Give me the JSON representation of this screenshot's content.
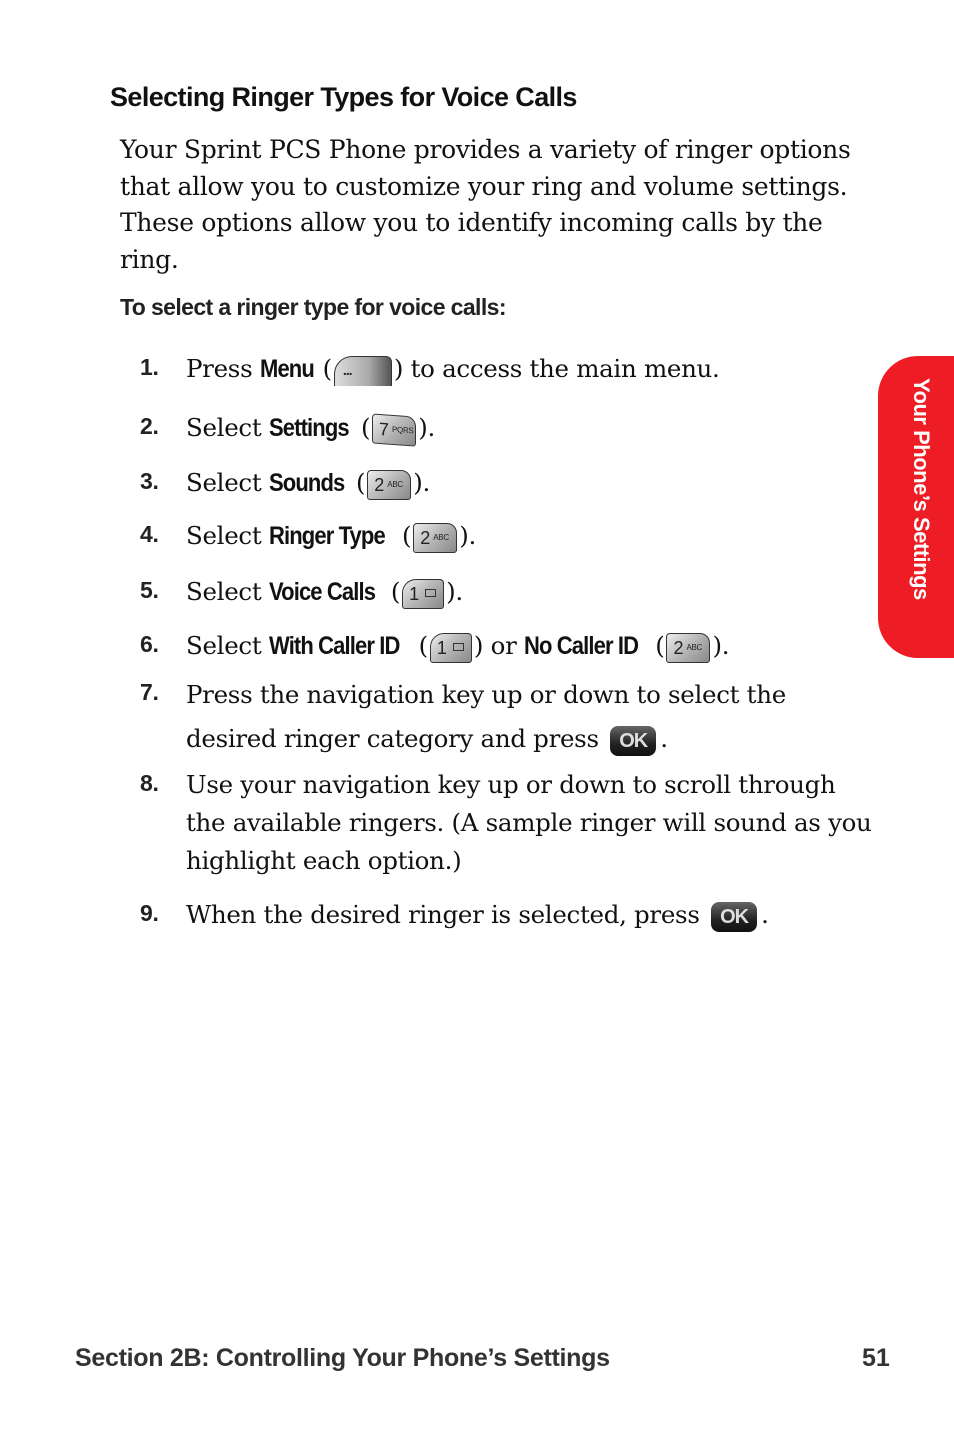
{
  "heading": "Selecting Ringer Types for Voice Calls",
  "intro": "Your Sprint PCS Phone provides a variety of ringer options that allow you to customize your ring and volume settings. These options allow you to identify incoming calls by the ring.",
  "subheading": "To select a ringer type for voice calls:",
  "steps": [
    {
      "num": "1.",
      "pre": "Press ",
      "kw": "Menu",
      "open": " (",
      "key": {
        "digit": "...",
        "letters": ""
      },
      "post": ") to access the main menu."
    },
    {
      "num": "2.",
      "pre": "Select ",
      "kw": "Settings",
      "open": " (",
      "key": {
        "digit": "7",
        "letters": "PQRS"
      },
      "post": ")."
    },
    {
      "num": "3.",
      "pre": "Select ",
      "kw": "Sounds",
      "open": " (",
      "key": {
        "digit": "2",
        "letters": "ABC"
      },
      "post": ")."
    },
    {
      "num": "4.",
      "pre": "Select ",
      "kw": "Ringer Type",
      "open": " (",
      "key": {
        "digit": "2",
        "letters": "ABC"
      },
      "post": ")."
    },
    {
      "num": "5.",
      "pre": "Select ",
      "kw": "Voice Calls",
      "open": " (",
      "key": {
        "digit": "1",
        "letters": ""
      },
      "post": ")."
    },
    {
      "num": "6.",
      "pre": "Select ",
      "kw": "With Caller ID",
      "open": " (",
      "key": {
        "digit": "1",
        "letters": ""
      },
      "mid": ") or ",
      "kw2": "No Caller ID",
      "open2": " (",
      "key2": {
        "digit": "2",
        "letters": "ABC"
      },
      "post": ")."
    },
    {
      "num": "7.",
      "text": "Press the navigation key up or down to select the desired ringer category and press",
      "key_label": "OK",
      "post": "."
    },
    {
      "num": "8.",
      "text": "Use your navigation key up or down to scroll through the available ringers. (A sample ringer will sound as you highlight each option.)"
    },
    {
      "num": "9.",
      "text": "When the desired ringer is selected, press",
      "key_label": "OK",
      "post": "."
    }
  ],
  "side_tab": {
    "label": "Your Phone’s Settings",
    "color": "#ee1c25"
  },
  "footer": {
    "section": "Section 2B: Controlling Your Phone’s Settings",
    "page": "51"
  }
}
